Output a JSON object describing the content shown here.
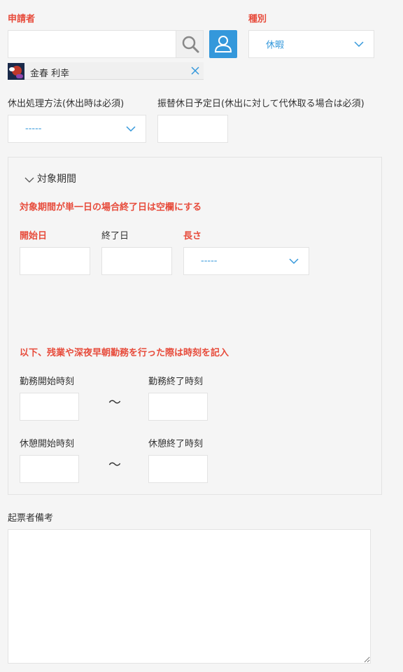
{
  "applicant": {
    "label": "申請者",
    "search_value": "",
    "user_name": "金春 利幸"
  },
  "type_field": {
    "label": "種別",
    "selected": "休暇"
  },
  "holiday_method": {
    "label": "休出処理方法(休出時は必須)",
    "selected": "-----"
  },
  "substitute_date": {
    "label": "振替休日予定日(休出に対して代休取る場合は必須)",
    "value": ""
  },
  "period_section": {
    "title": "対象期間",
    "note": "対象期間が単一日の場合終了日は空欄にする",
    "start_label": "開始日",
    "end_label": "終了日",
    "length_label": "長さ",
    "length_selected": "-----",
    "overtime_note": "以下、残業や深夜早朝勤務を行った際は時刻を記入",
    "work_start_label": "勤務開始時刻",
    "work_end_label": "勤務終了時刻",
    "break_start_label": "休憩開始時刻",
    "break_end_label": "休憩終了時刻",
    "tilde": "〜"
  },
  "remarks": {
    "label": "起票者備考",
    "value": ""
  },
  "colors": {
    "required": "#e74c3c",
    "accent": "#3498db",
    "border": "#e3e3e3"
  }
}
